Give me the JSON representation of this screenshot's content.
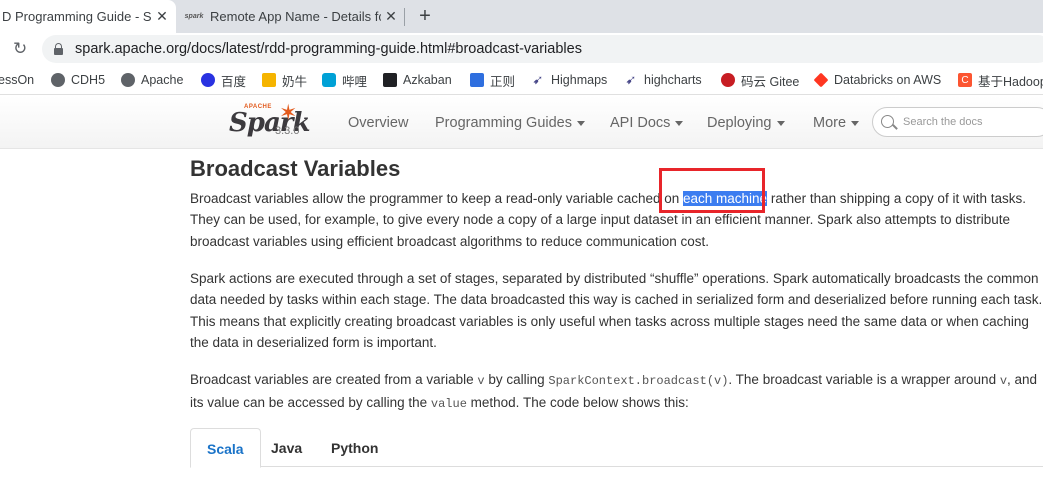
{
  "browser": {
    "tabs": [
      {
        "title": "D Programming Guide - Sp",
        "active": true
      },
      {
        "title": "Remote App Name - Details fc",
        "active": false
      }
    ],
    "favicon_text": "spark",
    "new_tab_glyph": "+",
    "close_glyph": "✕",
    "url": "spark.apache.org/docs/latest/rdd-programming-guide.html#broadcast-variables",
    "bookmarks": [
      {
        "label": "essOn",
        "icon": "none"
      },
      {
        "label": "CDH5",
        "icon": "globe-icon"
      },
      {
        "label": "Apache",
        "icon": "globe-icon"
      },
      {
        "label": "百度",
        "icon": "baidu-icon"
      },
      {
        "label": "奶牛",
        "icon": "cow-icon"
      },
      {
        "label": "哔哩",
        "icon": "bilibili-icon"
      },
      {
        "label": "Azkaban",
        "icon": "azkaban-icon"
      },
      {
        "label": "正则",
        "icon": "regex-icon"
      },
      {
        "label": "Highmaps",
        "icon": "highcharts-icon"
      },
      {
        "label": "highcharts",
        "icon": "highcharts-icon"
      },
      {
        "label": "码云 Gitee",
        "icon": "gitee-icon"
      },
      {
        "label": "Databricks on AWS",
        "icon": "databricks-icon"
      },
      {
        "label": "基于Hadoop",
        "icon": "csdn-icon"
      }
    ]
  },
  "site": {
    "logo_apache": "APACHE",
    "logo_word": "Spark",
    "version": "3.3.0",
    "nav": {
      "overview": "Overview",
      "programming_guides": "Programming Guides",
      "api_docs": "API Docs",
      "deploying": "Deploying",
      "more": "More"
    },
    "search_placeholder": "Search the docs"
  },
  "article": {
    "heading": "Broadcast Variables",
    "p1_before": "Broadcast variables allow the programmer to keep a read-only variable cached on ",
    "p1_highlight": "each machine",
    "p1_after": " rather than shipping a copy of it with tasks. They can be used, for example, to give every node a copy of a large input dataset in an efficient manner. Spark also attempts to distribute broadcast variables using efficient broadcast algorithms to reduce communication cost.",
    "p2": "Spark actions are executed through a set of stages, separated by distributed “shuffle” operations. Spark automatically broadcasts the common data needed by tasks within each stage. The data broadcasted this way is cached in serialized form and deserialized before running each task. This means that explicitly creating broadcast variables is only useful when tasks across multiple stages need the same data or when caching the data in deserialized form is important.",
    "p3_a": "Broadcast variables are created from a variable ",
    "p3_code1": "v",
    "p3_b": " by calling ",
    "p3_code2": "SparkContext.broadcast(v)",
    "p3_c": ". The broadcast variable is a wrapper around ",
    "p3_code3": "v",
    "p3_d": ", and its value can be accessed by calling the ",
    "p3_code4": "value",
    "p3_e": " method. The code below shows this:",
    "code_tabs": [
      "Scala",
      "Java",
      "Python"
    ]
  },
  "colors": {
    "highlight": "#3c7df0",
    "annotation_box": "#e8252a",
    "active_tab_text": "#1a73c8"
  }
}
